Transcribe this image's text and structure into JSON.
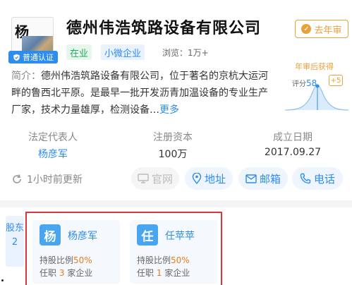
{
  "company": {
    "logo_char": "杨",
    "certification": "普通认证",
    "name": "德州伟浩筑路设备有限公司",
    "status_tag": "在业",
    "type_tag": "小微企业",
    "views_label": "浏览：",
    "views_value": "1万+",
    "audit_badge": "去年审",
    "intro_label": "简介：",
    "intro_text": "德州伟浩筑路设备有限公司，位于著名的京杭大运河畔的鲁西北平原。是最早一批开发沥青加温设备的专业生产厂家，技术力量雄厚，检测设备…",
    "intro_more": "更多"
  },
  "score": {
    "header": "年审后获得",
    "label": "评分",
    "value": "58",
    "bonus": "+5"
  },
  "info": [
    {
      "key": "法定代表人",
      "value": "杨彦军"
    },
    {
      "key": "注册资本",
      "value": "100万"
    },
    {
      "key": "成立日期",
      "value": "2017.09.27"
    }
  ],
  "update_text": "1小时前更新",
  "actions": {
    "website": "官网",
    "address": "地址",
    "email": "邮箱",
    "phone": "电话"
  },
  "shareholders": {
    "section_label": "股东",
    "count": "2",
    "items": [
      {
        "avatar": "杨",
        "name": "杨彦军",
        "ratio_label": "持股比例",
        "ratio": "50%",
        "post_prefix": "任职",
        "post_count": "3",
        "post_suffix": "家企业"
      },
      {
        "avatar": "任",
        "name": "任苹苹",
        "ratio_label": "持股比例",
        "ratio": "50%",
        "post_prefix": "任职",
        "post_count": "1",
        "post_suffix": "家企业"
      }
    ]
  },
  "colors": {
    "accent": "#2d8cf0",
    "status_green": "#1bae58",
    "audit_orange": "#e6a23c",
    "highlight_red": "#d9363e"
  }
}
